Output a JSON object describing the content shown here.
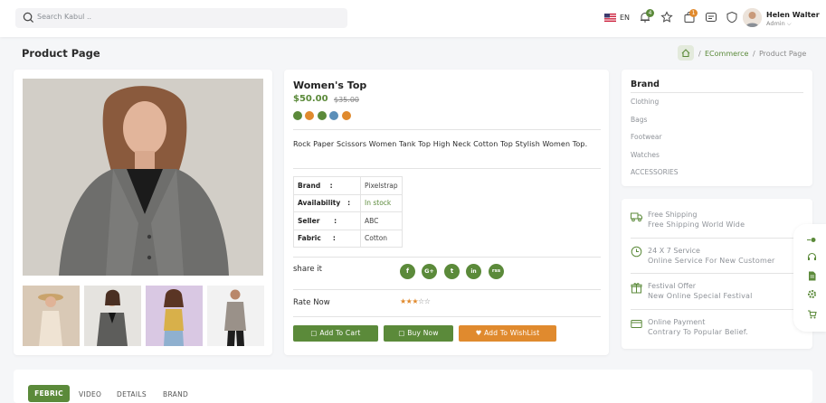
{
  "header": {
    "search_placeholder": "Search Kabul ..",
    "language": "EN",
    "notification_count": "4",
    "cart_count": "1",
    "user_name": "Helen Walter",
    "user_role": "Admin"
  },
  "page": {
    "title": "Product Page",
    "breadcrumb": [
      "ECommerce",
      "Product Page"
    ]
  },
  "product": {
    "name": "Women's Top",
    "price": "$50.00",
    "old_price": "$35.00",
    "colors": [
      "#5b8a3a",
      "#e08a2e",
      "#5b8a3a",
      "#5b8fb9",
      "#e08a2e"
    ],
    "description": "Rock Paper Scissors Women Tank Top High Neck Cotton Top Stylish Women Top.",
    "specs": [
      {
        "key": "Brand",
        "sep": ":",
        "value": "Pixelstrap"
      },
      {
        "key": "Availability",
        "sep": ":",
        "value": "In stock"
      },
      {
        "key": "Seller",
        "sep": ":",
        "value": "ABC"
      },
      {
        "key": "Fabric",
        "sep": ":",
        "value": "Cotton"
      }
    ],
    "share_label": "share it",
    "social": [
      "f",
      "G+",
      "t",
      "in",
      "rss"
    ],
    "rate_label": "Rate Now",
    "rating": 3,
    "buttons": {
      "add_to_cart": "Add To Cart",
      "buy_now": "Buy Now",
      "add_to_wishlist": "Add To WishList"
    }
  },
  "brand": {
    "title": "Brand",
    "items": [
      "Clothing",
      "Bags",
      "Footwear",
      "Watches",
      "ACCESSORIES"
    ]
  },
  "services": [
    {
      "icon": "truck-icon",
      "title": "Free Shipping",
      "subtitle": "Free Shipping World Wide"
    },
    {
      "icon": "clock-icon",
      "title": "24 X 7 Service",
      "subtitle": "Online Service For New Customer"
    },
    {
      "icon": "gift-icon",
      "title": "Festival Offer",
      "subtitle": "New Online Special Festival"
    },
    {
      "icon": "card-icon",
      "title": "Online Payment",
      "subtitle": "Contrary To Popular Belief."
    }
  ],
  "tabs": [
    "FEBRIC",
    "VIDEO",
    "DETAILS",
    "BRAND"
  ],
  "colors": {
    "accent": "#5b8a3a",
    "wishlist": "#e08a2e",
    "stock": "#5b8a3a"
  }
}
